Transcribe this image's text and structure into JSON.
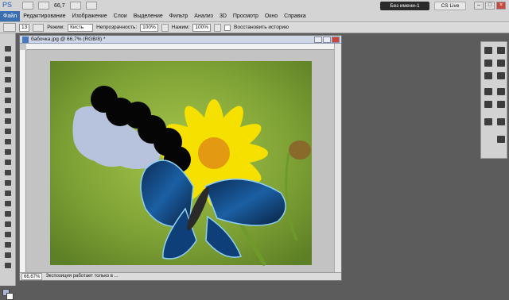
{
  "app": {
    "logo": "PS",
    "zoom": "66,7",
    "workspace_badge": "Без имени-1",
    "cs_live": "CS Live",
    "win_min": "–",
    "win_max": "□",
    "win_close": "×"
  },
  "menu": [
    "Файл",
    "Редактирование",
    "Изображение",
    "Слои",
    "Выделение",
    "Фильтр",
    "Анализ",
    "3D",
    "Просмотр",
    "Окно",
    "Справка"
  ],
  "options": {
    "brush_size": "13",
    "mode_label": "Режим:",
    "mode_value": "Кисть",
    "opacity_label": "Непрозрачность:",
    "opacity_value": "100%",
    "pressure_label": "Нажим:",
    "pressure_value": "100%",
    "history_label": "Восстановить историю"
  },
  "document": {
    "title": "бабочка.jpg @ 66,7% (RGB/8) *",
    "status_zoom": "66,67%",
    "status_text": "Экспозиция работает только в ..."
  },
  "colors": {
    "foreground": "#a9b5d6",
    "background": "#ffffff",
    "accent": "#3c6fb0"
  }
}
